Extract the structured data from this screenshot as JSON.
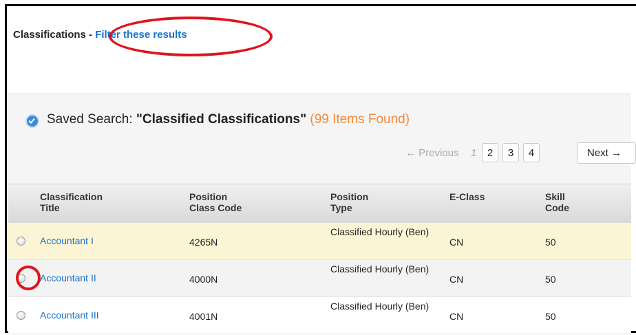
{
  "header": {
    "title": "Classifications",
    "separator": " - ",
    "filter_link": "Filter these results"
  },
  "saved_search": {
    "prefix": "Saved Search: ",
    "name": "\"Classified Classifications\"",
    "count": "(99 Items Found)"
  },
  "pagination": {
    "previous": "← Previous",
    "current": "1",
    "pages": [
      "2",
      "3",
      "4"
    ],
    "next": "Next →"
  },
  "table": {
    "columns": [
      [
        "Classification",
        "Title"
      ],
      [
        "Position",
        "Class Code"
      ],
      [
        "Position",
        "Type"
      ],
      [
        "",
        "E-Class"
      ],
      [
        "Skill",
        "Code"
      ]
    ],
    "rows": [
      {
        "title": "Accountant I",
        "code": "4265N",
        "type": "Classified Hourly (Ben)",
        "eclass": "CN",
        "skill": "50"
      },
      {
        "title": "Accountant II",
        "code": "4000N",
        "type": "Classified Hourly (Ben)",
        "eclass": "CN",
        "skill": "50"
      },
      {
        "title": "Accountant III",
        "code": "4001N",
        "type": "Classified Hourly (Ben)",
        "eclass": "CN",
        "skill": "50"
      }
    ]
  },
  "colors": {
    "link": "#1a73c9",
    "count": "#f08a3c",
    "highlight_row": "#fcf5d5",
    "annotation": "#e0141c"
  }
}
